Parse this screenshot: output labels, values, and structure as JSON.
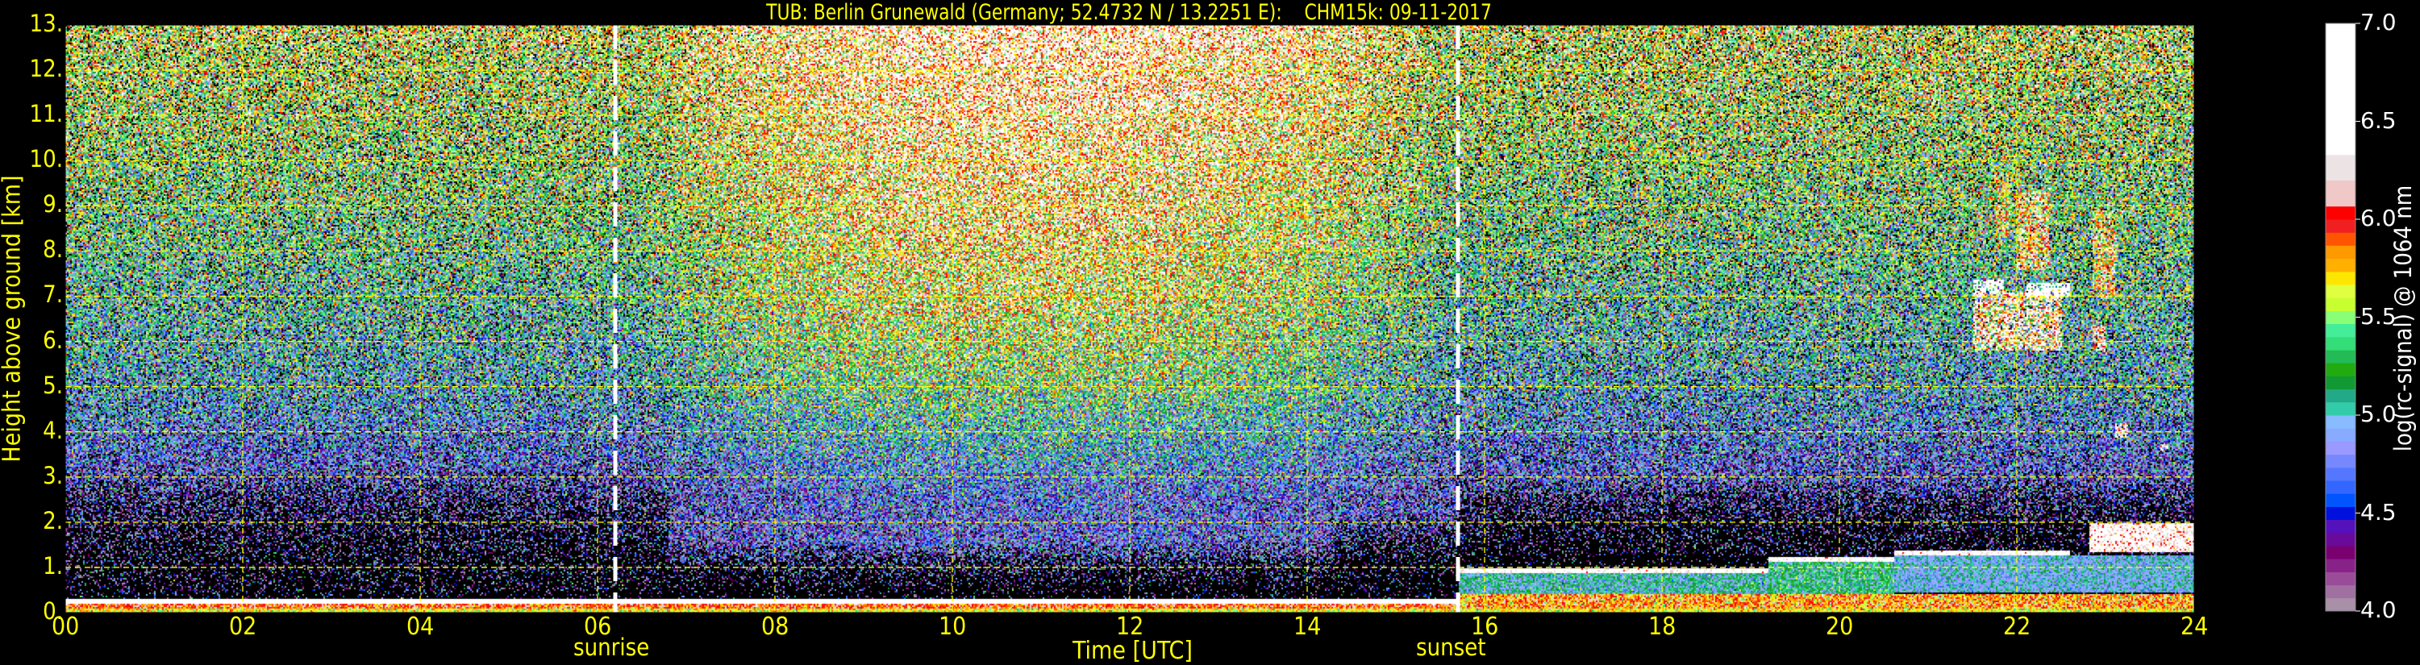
{
  "chart_data": {
    "type": "heatmap",
    "title": "TUB: Berlin Grunewald (Germany; 52.4732 N / 13.2251 E):    CHM15k: 09-11-2017",
    "xlabel": "Time [UTC]",
    "ylabel": "Height above ground [km]",
    "xlim": [
      0,
      24
    ],
    "ylim": [
      0,
      13
    ],
    "x_ticks": [
      0,
      2,
      4,
      6,
      8,
      10,
      12,
      14,
      16,
      18,
      20,
      22,
      24
    ],
    "x_tick_labels": [
      "00",
      "02",
      "04",
      "06",
      "08",
      "10",
      "12",
      "14",
      "16",
      "18",
      "20",
      "22",
      "24"
    ],
    "y_ticks": [
      0,
      1,
      2,
      3,
      4,
      5,
      6,
      7,
      8,
      9,
      10,
      11,
      12,
      13
    ],
    "y_tick_labels": [
      "0.",
      "1.",
      "2.",
      "3.",
      "4.",
      "5.",
      "6.",
      "7.",
      "8.",
      "9.",
      "10.",
      "11.",
      "12.",
      "13."
    ],
    "grid": true,
    "annotations": [
      {
        "label": "sunrise",
        "time": 6.2
      },
      {
        "label": "sunset",
        "time": 15.7
      }
    ],
    "colorbar": {
      "label": "log(rc-signal) @ 1064 nm",
      "range": [
        4.0,
        7.0
      ],
      "ticks": [
        4.0,
        4.5,
        5.0,
        5.5,
        6.0,
        6.5,
        7.0
      ],
      "tick_labels": [
        "4.0",
        "4.5",
        "5.0",
        "5.5",
        "6.0",
        "6.5",
        "7.0"
      ],
      "colors": [
        "#a890a8",
        "#a070a0",
        "#9a4c99",
        "#882288",
        "#7a0070",
        "#6a0a9a",
        "#5511bb",
        "#0011dd",
        "#0055ff",
        "#3366ff",
        "#5577ff",
        "#7788ff",
        "#9999ff",
        "#88aaff",
        "#88bbff",
        "#33ccaa",
        "#22aa88",
        "#119933",
        "#22aa11",
        "#22bb55",
        "#33dd77",
        "#44ee99",
        "#88ff77",
        "#c8ff30",
        "#e0ff40",
        "#ffe600",
        "#ffb000",
        "#ff9900",
        "#ff5500",
        "#f02020",
        "#ff0000",
        "#f0c8c8",
        "#ece4e4",
        "#ffffff"
      ],
      "bounds": [
        4.0,
        4.067,
        4.133,
        4.2,
        4.267,
        4.333,
        4.4,
        4.467,
        4.533,
        4.6,
        4.667,
        4.733,
        4.8,
        4.867,
        4.933,
        5.0,
        5.067,
        5.133,
        5.2,
        5.267,
        5.333,
        5.4,
        5.467,
        5.533,
        5.6,
        5.667,
        5.733,
        5.8,
        5.867,
        5.933,
        6.0,
        6.067,
        6.2,
        6.33,
        7.0
      ]
    },
    "background_signal": {
      "description_units": "log(rc-signal)",
      "mean_by_height": [
        [
          0,
          4.4
        ],
        [
          2.5,
          4.4
        ],
        [
          5,
          4.95
        ],
        [
          9,
          5.35
        ],
        [
          13,
          5.67
        ]
      ],
      "daytime_increase": 0.6,
      "daytime_hours": [
        6.5,
        15.5
      ],
      "spread": 0.45
    },
    "layers": [
      {
        "name": "surface-yellow",
        "t": [
          0,
          24
        ],
        "h": [
          0,
          0.1
        ],
        "value": 5.65,
        "spread": 0.15
      },
      {
        "name": "surface-red",
        "t": [
          0,
          24
        ],
        "h": [
          0.1,
          0.2
        ],
        "value": 5.95,
        "spread": 0.15
      },
      {
        "name": "surface-white",
        "t": [
          0,
          15.7
        ],
        "h": [
          0.2,
          0.33
        ],
        "value": 6.6,
        "spread": 0.1
      },
      {
        "name": "residual-orange",
        "t": [
          15.7,
          24
        ],
        "h": [
          0.1,
          0.42
        ],
        "value": 5.85,
        "spread": 0.2
      },
      {
        "name": "boundary-layer",
        "t": [
          15.7,
          19.2
        ],
        "h": [
          0.42,
          0.9
        ],
        "value": 5.05,
        "spread": 0.2
      },
      {
        "name": "boundary-layer",
        "t": [
          19.2,
          20.6
        ],
        "h": [
          0.42,
          1.15
        ],
        "value": 5.15,
        "spread": 0.2
      },
      {
        "name": "boundary-layer",
        "t": [
          20.6,
          24
        ],
        "h": [
          0.45,
          1.28
        ],
        "value": 4.95,
        "spread": 0.15
      },
      {
        "name": "bl-top",
        "t": [
          15.7,
          19.2
        ],
        "h": [
          0.9,
          1.0
        ],
        "value": 6.5,
        "spread": 0.2
      },
      {
        "name": "bl-top",
        "t": [
          19.2,
          20.6
        ],
        "h": [
          1.15,
          1.25
        ],
        "value": 6.5,
        "spread": 0.2
      },
      {
        "name": "bl-top",
        "t": [
          20.6,
          22.6
        ],
        "h": [
          1.28,
          1.38
        ],
        "value": 6.5,
        "spread": 0.2
      },
      {
        "name": "aerosol-layer",
        "t": [
          22.8,
          24
        ],
        "h": [
          1.35,
          2.0
        ],
        "value": 6.45,
        "spread": 0.3
      },
      {
        "name": "mid-cloud",
        "t": [
          21.5,
          22.5
        ],
        "h": [
          5.8,
          7.1
        ],
        "value": 6.2,
        "spread": 0.45
      },
      {
        "name": "mid-cloud-top",
        "t": [
          21.5,
          21.85
        ],
        "h": [
          7.1,
          7.4
        ],
        "value": 6.6,
        "spread": 0.1
      },
      {
        "name": "mid-cloud-top",
        "t": [
          22.1,
          22.6
        ],
        "h": [
          7.0,
          7.3
        ],
        "value": 6.6,
        "spread": 0.1
      },
      {
        "name": "cirrus",
        "t": [
          21.75,
          21.9
        ],
        "h": [
          8.3,
          9.7
        ],
        "value": 5.85,
        "spread": 0.3
      },
      {
        "name": "cirrus",
        "t": [
          22.0,
          22.35
        ],
        "h": [
          7.6,
          9.3
        ],
        "value": 6.0,
        "spread": 0.35
      },
      {
        "name": "cirrus",
        "t": [
          22.85,
          23.1
        ],
        "h": [
          7.0,
          8.9
        ],
        "value": 5.9,
        "spread": 0.35
      },
      {
        "name": "small-cloud",
        "t": [
          22.85,
          23.0
        ],
        "h": [
          5.8,
          6.4
        ],
        "value": 6.2,
        "spread": 0.3
      },
      {
        "name": "small-aerosol",
        "t": [
          23.1,
          23.25
        ],
        "h": [
          3.9,
          4.2
        ],
        "value": 6.3,
        "spread": 0.3
      },
      {
        "name": "small-aerosol",
        "t": [
          23.6,
          23.7
        ],
        "h": [
          3.6,
          3.75
        ],
        "value": 6.3,
        "spread": 0.3
      }
    ]
  }
}
